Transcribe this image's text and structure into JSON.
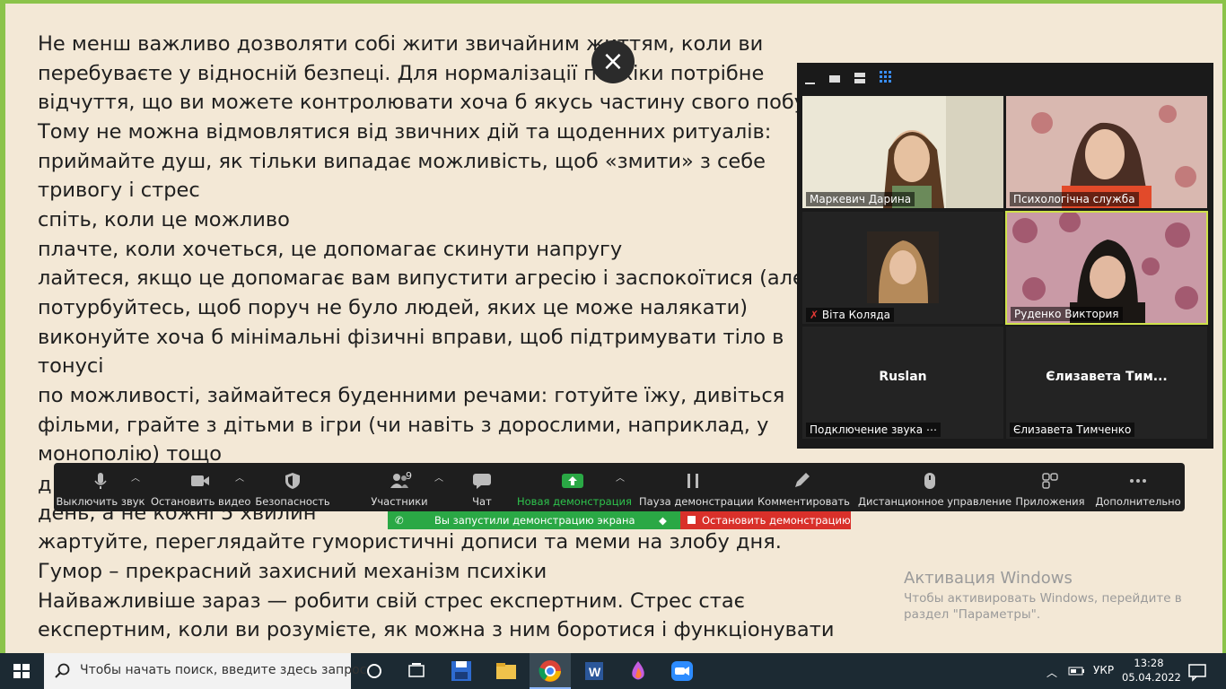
{
  "document": {
    "lines": [
      " Не менш важливо дозволяти собі жити звичайним життям, коли ви",
      "перебуваєте у відносній безпеці. Для нормалізації психіки потрібне",
      "відчуття, що ви можете контролювати хоча б якусь частину свого побуту.",
      "Тому не можна відмовлятися від звичних дій та щоденних ритуалів:",
      " приймайте душ, як тільки випадає можливість, щоб «змити» з себе",
      "тривогу і стрес",
      " спіть, коли це можливо",
      " плачте, коли хочеться, це допомагає скинути напругу",
      " лайтеся, якщо це допомагає вам випустити агресію і заспокоїтися (але",
      "потурбуйтесь, щоб поруч не було людей, яких це може налякати)",
      " виконуйте хоча б мінімальні фізичні вправи, щоб підтримувати тіло в",
      "тонусі",
      " по можливості, займайтеся буденними речами: готуйте їжу, дивіться",
      "фільми, грайте з дітьми в ігри (чи навіть з дорослими, наприклад, у",
      "монополію) тощо",
      " д",
      "день, а не кожні 5 хвилин",
      " жартуйте, переглядайте гумористичні дописи та меми на злобу дня.",
      "Гумор – прекрасний захисний механізм психіки",
      " Найважливіше зараз — робити свій стрес експертним. Стрес стає",
      "експертним, коли ви розумієте, як можна з ним боротися і функціонувати"
    ]
  },
  "overlay": {
    "close_icon": "×"
  },
  "gallery": {
    "participants": [
      {
        "name": "Маркевич Дарина",
        "video": true,
        "muted": false,
        "active": false,
        "bg": "#e8e3d0"
      },
      {
        "name": "Психологічна служба",
        "video": true,
        "muted": false,
        "active": false,
        "bg": "#c9a99a"
      },
      {
        "name": "Віта Коляда",
        "video": true,
        "muted": true,
        "active": false,
        "bg": "#2a2420"
      },
      {
        "name": "Руденко  Виктория",
        "video": true,
        "muted": false,
        "active": true,
        "bg": "#c28a9a"
      },
      {
        "name": "Подключение звука ⋯",
        "display": "Ruslan",
        "video": false
      },
      {
        "name": "Єлизавета Тимченко",
        "display": "Єлизавета  Тим...",
        "video": false
      }
    ]
  },
  "toolbar": {
    "mute": "Выключить звук",
    "video": "Остановить видео",
    "security": "Безопасность",
    "participants": "Участники",
    "participants_count": "9",
    "chat": "Чат",
    "new_share": "Новая демонстрация",
    "pause_share": "Пауза демонстрации",
    "annotate": "Комментировать",
    "remote": "Дистанционное управление",
    "apps": "Приложения",
    "more": "Дополнительно"
  },
  "share_status": {
    "started": "Вы запустили демонстрацию экрана",
    "stop": "Остановить демонстрацию"
  },
  "windows_activation": {
    "title": "Активация Windows",
    "line1": "Чтобы активировать Windows, перейдите в",
    "line2": "раздел \"Параметры\"."
  },
  "taskbar": {
    "search_placeholder": "Чтобы начать поиск, введите здесь запрос",
    "lang": "УКР",
    "time": "13:28",
    "date": "05.04.2022"
  },
  "colors": {
    "page_bg": "#f3e8d6",
    "edge": "#8bc34a",
    "share_green": "#2aa845",
    "stop_red": "#d9302a",
    "active_speaker": "#cfe24a"
  }
}
